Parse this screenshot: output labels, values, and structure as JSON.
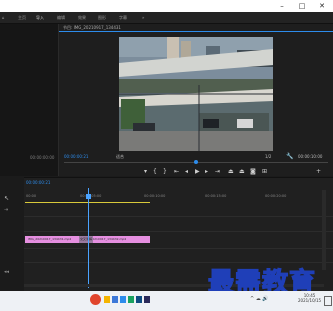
{
  "menubar": {
    "items": [
      {
        "label": "主页"
      },
      {
        "label": "导入"
      },
      {
        "label": "编辑"
      },
      {
        "label": "效果"
      },
      {
        "label": "图形"
      },
      {
        "label": "字幕"
      }
    ]
  },
  "program": {
    "title": "节目: IMG_20210917_134431",
    "timecode_current": "00:00:00:21",
    "fit_label": "适合",
    "fraction_label": "1/2",
    "timecode_total": "00:00:10:00"
  },
  "source": {
    "timecode": "00:00:00:00"
  },
  "timeline": {
    "timecode": "00:00:00:21",
    "ruler": [
      "00:00",
      "00:00:05:00",
      "00:00:10:00",
      "00:00:15:00",
      "00:00:20:00"
    ],
    "clips": [
      {
        "label": "IMG_20210917_134431.mp4"
      },
      {
        "label": "IMG_20210917_134432.mp4"
      }
    ],
    "transition_label": "交叉溶解"
  },
  "taskbar": {
    "time": "10:45",
    "date": "2021/10/15"
  },
  "watermark": {
    "text": "最需教育"
  },
  "colors": {
    "clip": "#e58fe0",
    "playhead": "#4aa3ff",
    "accent": "#2d8ceb"
  }
}
